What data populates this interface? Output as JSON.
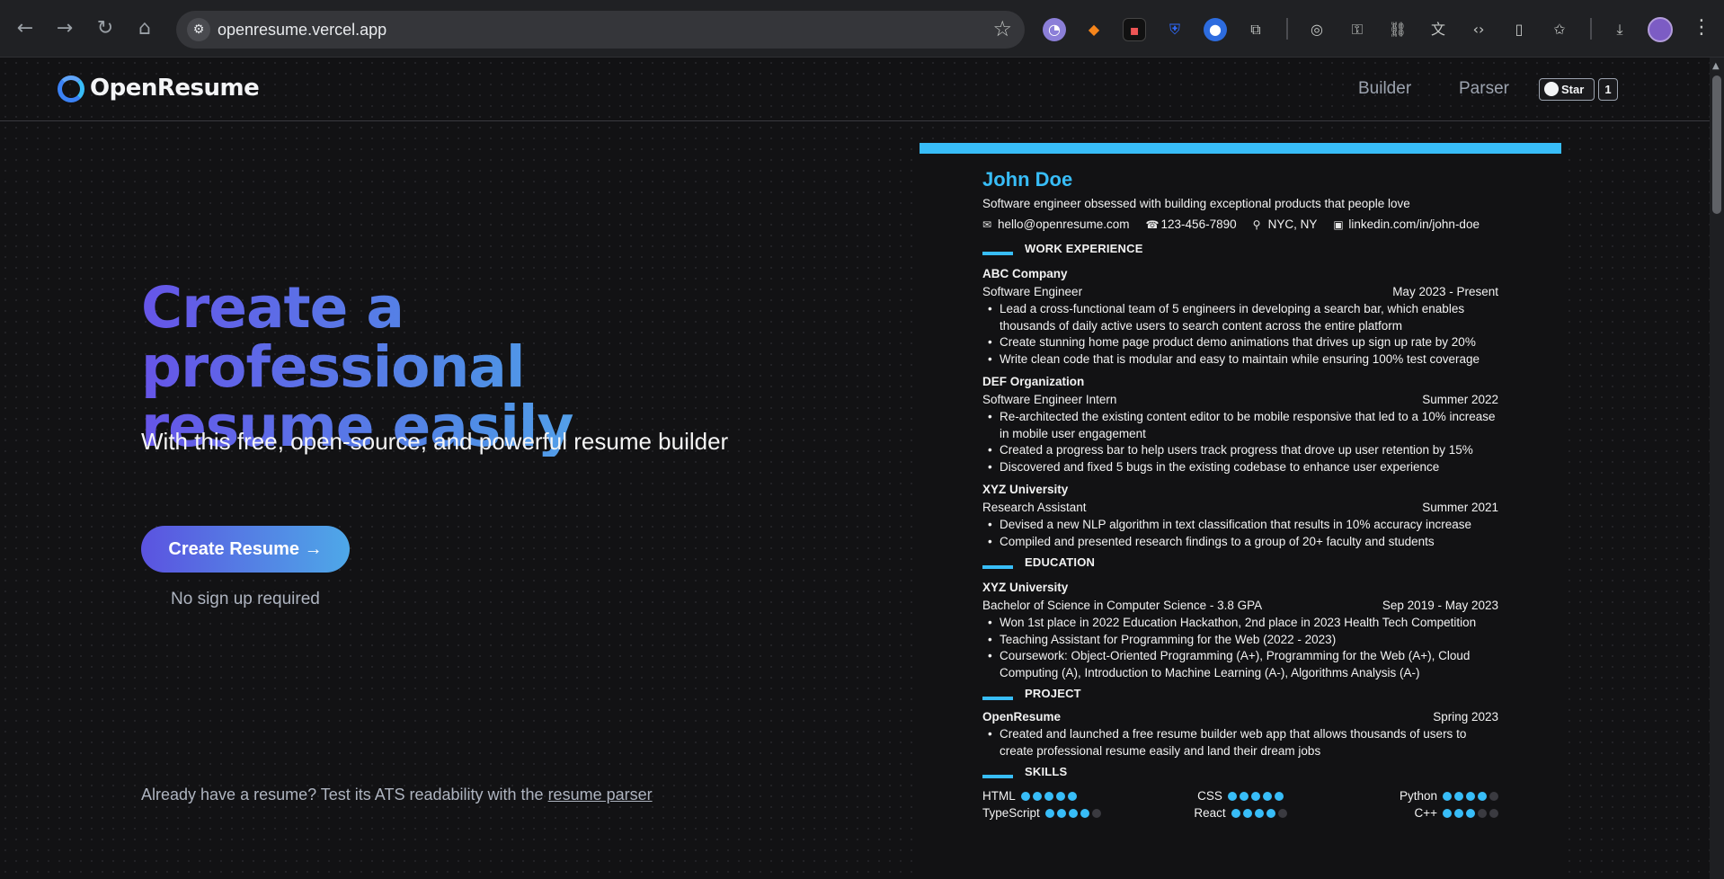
{
  "browser": {
    "url": "openresume.vercel.app",
    "back_icon": "←",
    "forward_icon": "→",
    "reload_icon": "↻",
    "home_icon": "⌂",
    "star_icon": "☆",
    "menu_icon": "⋮"
  },
  "nav": {
    "brand": "OpenResume",
    "builder": "Builder",
    "parser": "Parser",
    "star_label": "Star",
    "star_count": "1"
  },
  "hero": {
    "title": "Create a professional resume easily",
    "subtitle": "With this free, open-source, and powerful resume builder",
    "cta": "Create Resume →",
    "no_signup": "No sign up required",
    "parser_prefix": "Already have a resume? Test its ATS readability with the ",
    "parser_link": "resume parser"
  },
  "resume": {
    "name": "John Doe",
    "summary": "Software engineer obsessed with building exceptional products that people love",
    "contacts": {
      "email": "hello@openresume.com",
      "phone": "123-456-7890",
      "location": "NYC, NY",
      "linkedin": "linkedin.com/in/john-doe"
    },
    "work_heading": "WORK EXPERIENCE",
    "work": [
      {
        "company": "ABC Company",
        "title": "Software Engineer",
        "date": "May 2023 - Present",
        "bullets": [
          "Lead a cross-functional team of 5 engineers in developing a search bar, which enables thousands of daily active users to search content across the entire platform",
          "Create stunning home page product demo animations that drives up sign up rate by 20%",
          "Write clean code that is modular and easy to maintain while ensuring 100% test coverage"
        ]
      },
      {
        "company": "DEF Organization",
        "title": "Software Engineer Intern",
        "date": "Summer 2022",
        "bullets": [
          "Re-architected the existing content editor to be mobile responsive that led to a 10% increase in mobile user engagement",
          "Created a progress bar to help users track progress that drove up user retention by 15%",
          "Discovered and fixed 5 bugs in the existing codebase to enhance user experience"
        ]
      },
      {
        "company": "XYZ University",
        "title": "Research Assistant",
        "date": "Summer 2021",
        "bullets": [
          "Devised a new NLP algorithm in text classification that results in 10% accuracy increase",
          "Compiled and presented research findings to a group of 20+ faculty and students"
        ]
      }
    ],
    "education_heading": "EDUCATION",
    "education": {
      "school": "XYZ University",
      "degree": "Bachelor of Science in Computer Science - 3.8 GPA",
      "date": "Sep 2019 - May 2023",
      "bullets": [
        "Won 1st place in 2022 Education Hackathon, 2nd place in 2023 Health Tech Competition",
        "Teaching Assistant for Programming for the Web (2022 - 2023)",
        "Coursework: Object-Oriented Programming (A+), Programming for the Web (A+), Cloud Computing (A), Introduction to Machine Learning (A-), Algorithms Analysis (A-)"
      ]
    },
    "project_heading": "PROJECT",
    "project": {
      "name": "OpenResume",
      "date": "Spring 2023",
      "bullets": [
        "Created and launched a free resume builder web app that allows thousands of users to create professional resume easily and land their dream jobs"
      ]
    },
    "skills_heading": "SKILLS",
    "skills": [
      {
        "name": "HTML",
        "rating": 5
      },
      {
        "name": "CSS",
        "rating": 5
      },
      {
        "name": "Python",
        "rating": 4
      },
      {
        "name": "TypeScript",
        "rating": 4
      },
      {
        "name": "React",
        "rating": 4
      },
      {
        "name": "C++",
        "rating": 3
      }
    ],
    "accent_color": "#38bdf8"
  }
}
